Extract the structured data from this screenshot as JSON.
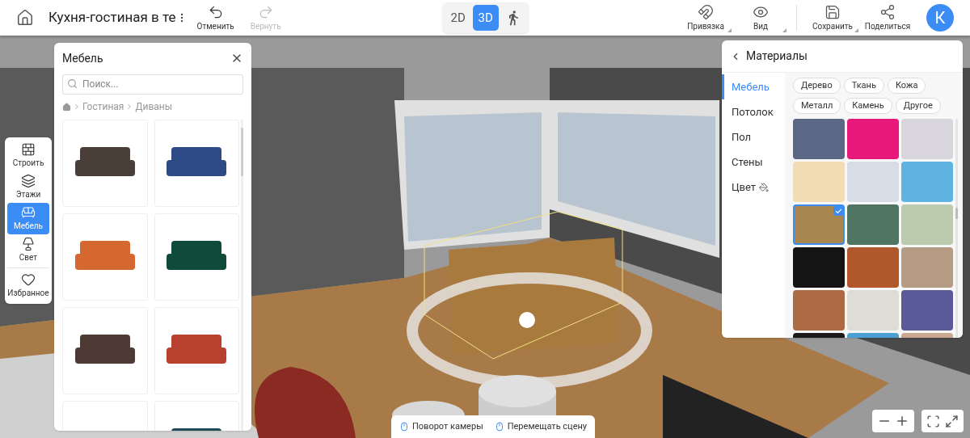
{
  "header": {
    "title": "Кухня-гостиная в те",
    "undo": {
      "label": "Отменить",
      "disabled": false
    },
    "redo": {
      "label": "Вернуть",
      "disabled": true
    },
    "view_modes": [
      {
        "kind": "text",
        "label": "2D",
        "selected": false
      },
      {
        "kind": "text",
        "label": "3D",
        "selected": true
      },
      {
        "kind": "walk",
        "selected": false
      }
    ],
    "tools": [
      {
        "kind": "magnet",
        "label": "Привязка",
        "dropdown": true
      },
      {
        "kind": "eye",
        "label": "Вид",
        "dropdown": true
      },
      {
        "kind": "save",
        "label": "Сохранить",
        "dropdown": true
      },
      {
        "kind": "share",
        "label": "Поделиться",
        "dropdown": false
      }
    ],
    "avatar": "К"
  },
  "tool_rail": [
    {
      "kind": "build",
      "label": "Строить",
      "selected": false
    },
    {
      "kind": "floors",
      "label": "Этажи",
      "selected": false
    },
    {
      "kind": "furniture",
      "label": "Мебель",
      "selected": true
    },
    {
      "kind": "light",
      "label": "Свет",
      "selected": false
    },
    {
      "kind": "favorites",
      "label": "Избранное",
      "selected": false
    }
  ],
  "furniture_panel": {
    "title": "Мебель",
    "search": {
      "placeholder": "Поиск..."
    },
    "breadcrumb": [
      "Гостиная",
      "Диваны"
    ],
    "items": [
      {
        "kind": "sofa",
        "color": "#4a3f38"
      },
      {
        "kind": "sofa",
        "color": "#2e4a86"
      },
      {
        "kind": "sofa",
        "color": "#d4682e"
      },
      {
        "kind": "sofa",
        "color": "#0f4a3a"
      },
      {
        "kind": "sofa",
        "color": "#4d3a34"
      },
      {
        "kind": "sofa",
        "color": "#b8402e"
      },
      {
        "kind": "blank"
      },
      {
        "kind": "sofa",
        "color": "#1e4a5a"
      }
    ]
  },
  "materials_panel": {
    "title": "Материалы",
    "tabs": [
      {
        "label": "Мебель",
        "selected": true,
        "kind": "text"
      },
      {
        "label": "Потолок",
        "selected": false,
        "kind": "text"
      },
      {
        "label": "Пол",
        "selected": false,
        "kind": "text"
      },
      {
        "label": "Стены",
        "selected": false,
        "kind": "text"
      },
      {
        "label": "Цвет",
        "selected": false,
        "kind": "color"
      }
    ],
    "filters": [
      "Дерево",
      "Ткань",
      "Кожа",
      "Металл",
      "Камень",
      "Другое"
    ],
    "swatches": [
      {
        "color": "#5c6785",
        "selected": false
      },
      {
        "color": "#e8187a",
        "selected": false
      },
      {
        "color": "#d8d6dc",
        "selected": false
      },
      {
        "color": "#f2dcb4",
        "selected": false
      },
      {
        "color": "#d6dde6",
        "selected": false
      },
      {
        "color": "#5fb3e0",
        "selected": false
      },
      {
        "color": "#a8874e",
        "selected": true
      },
      {
        "color": "#4f7462",
        "selected": false
      },
      {
        "color": "#bccaae",
        "selected": false
      },
      {
        "color": "#141414",
        "selected": false
      },
      {
        "color": "#b0582c",
        "selected": false
      },
      {
        "color": "#b59a84",
        "selected": false
      },
      {
        "color": "#ad6a44",
        "selected": false
      },
      {
        "color": "#deddd5",
        "selected": false
      },
      {
        "color": "#5a5a9a",
        "selected": false
      },
      {
        "color": "#1a1a1a",
        "selected": false
      },
      {
        "color": "#4aa0d0",
        "selected": false
      },
      {
        "color": "#c8a890",
        "selected": false
      }
    ]
  },
  "hints": [
    {
      "label": "Поворот камеры"
    },
    {
      "label": "Перемещать сцену"
    }
  ]
}
